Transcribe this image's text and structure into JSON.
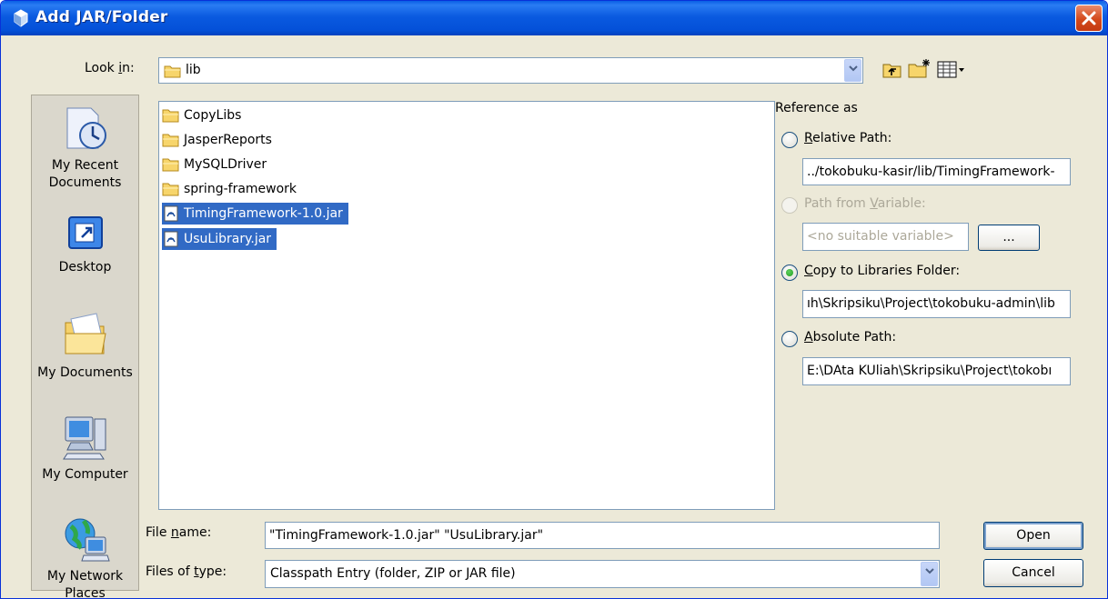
{
  "window": {
    "title": "Add JAR/Folder"
  },
  "look_in": {
    "label_pre": "Look ",
    "label_u": "i",
    "label_post": "n:",
    "value": "lib"
  },
  "places": [
    {
      "label": "My Recent Documents",
      "icon": "recent-documents-icon"
    },
    {
      "label": "Desktop",
      "icon": "desktop-icon"
    },
    {
      "label": "My Documents",
      "icon": "my-documents-icon"
    },
    {
      "label": "My Computer",
      "icon": "my-computer-icon"
    },
    {
      "label": "My Network Places",
      "icon": "network-places-icon"
    }
  ],
  "files": [
    {
      "name": "CopyLibs",
      "kind": "folder",
      "selected": false
    },
    {
      "name": "JasperReports",
      "kind": "folder",
      "selected": false
    },
    {
      "name": "MySQLDriver",
      "kind": "folder",
      "selected": false
    },
    {
      "name": "spring-framework",
      "kind": "folder",
      "selected": false
    },
    {
      "name": "TimingFramework-1.0.jar",
      "kind": "jar",
      "selected": true
    },
    {
      "name": "UsuLibrary.jar",
      "kind": "jar",
      "selected": true
    }
  ],
  "reference": {
    "heading": "Reference as",
    "relative": {
      "u": "R",
      "rest": "elative Path:",
      "value": "../tokobuku-kasir/lib/TimingFramework-"
    },
    "variable": {
      "pre": "Path from ",
      "u": "V",
      "rest": "ariable:",
      "value": "<no suitable variable>",
      "button": "..."
    },
    "copy": {
      "u": "C",
      "rest": "opy to Libraries Folder:",
      "value": "ıh\\Skripsiku\\Project\\tokobuku-admin\\lib"
    },
    "absolute": {
      "u": "A",
      "rest": "bsolute Path:",
      "value": "E:\\DAta KUliah\\Skripsiku\\Project\\tokobı"
    }
  },
  "file_name": {
    "label_pre": "File ",
    "label_u": "n",
    "label_post": "ame:",
    "value": "\"TimingFramework-1.0.jar\" \"UsuLibrary.jar\""
  },
  "file_type": {
    "label_pre": "Files of ",
    "label_u": "t",
    "label_post": "ype:",
    "value": "Classpath Entry (folder, ZIP or JAR file)"
  },
  "buttons": {
    "open": "Open",
    "cancel": "Cancel"
  },
  "colors": {
    "title_bar": "#0a5ae0",
    "selection": "#316ac5",
    "dialog_bg": "#ece9d8"
  }
}
